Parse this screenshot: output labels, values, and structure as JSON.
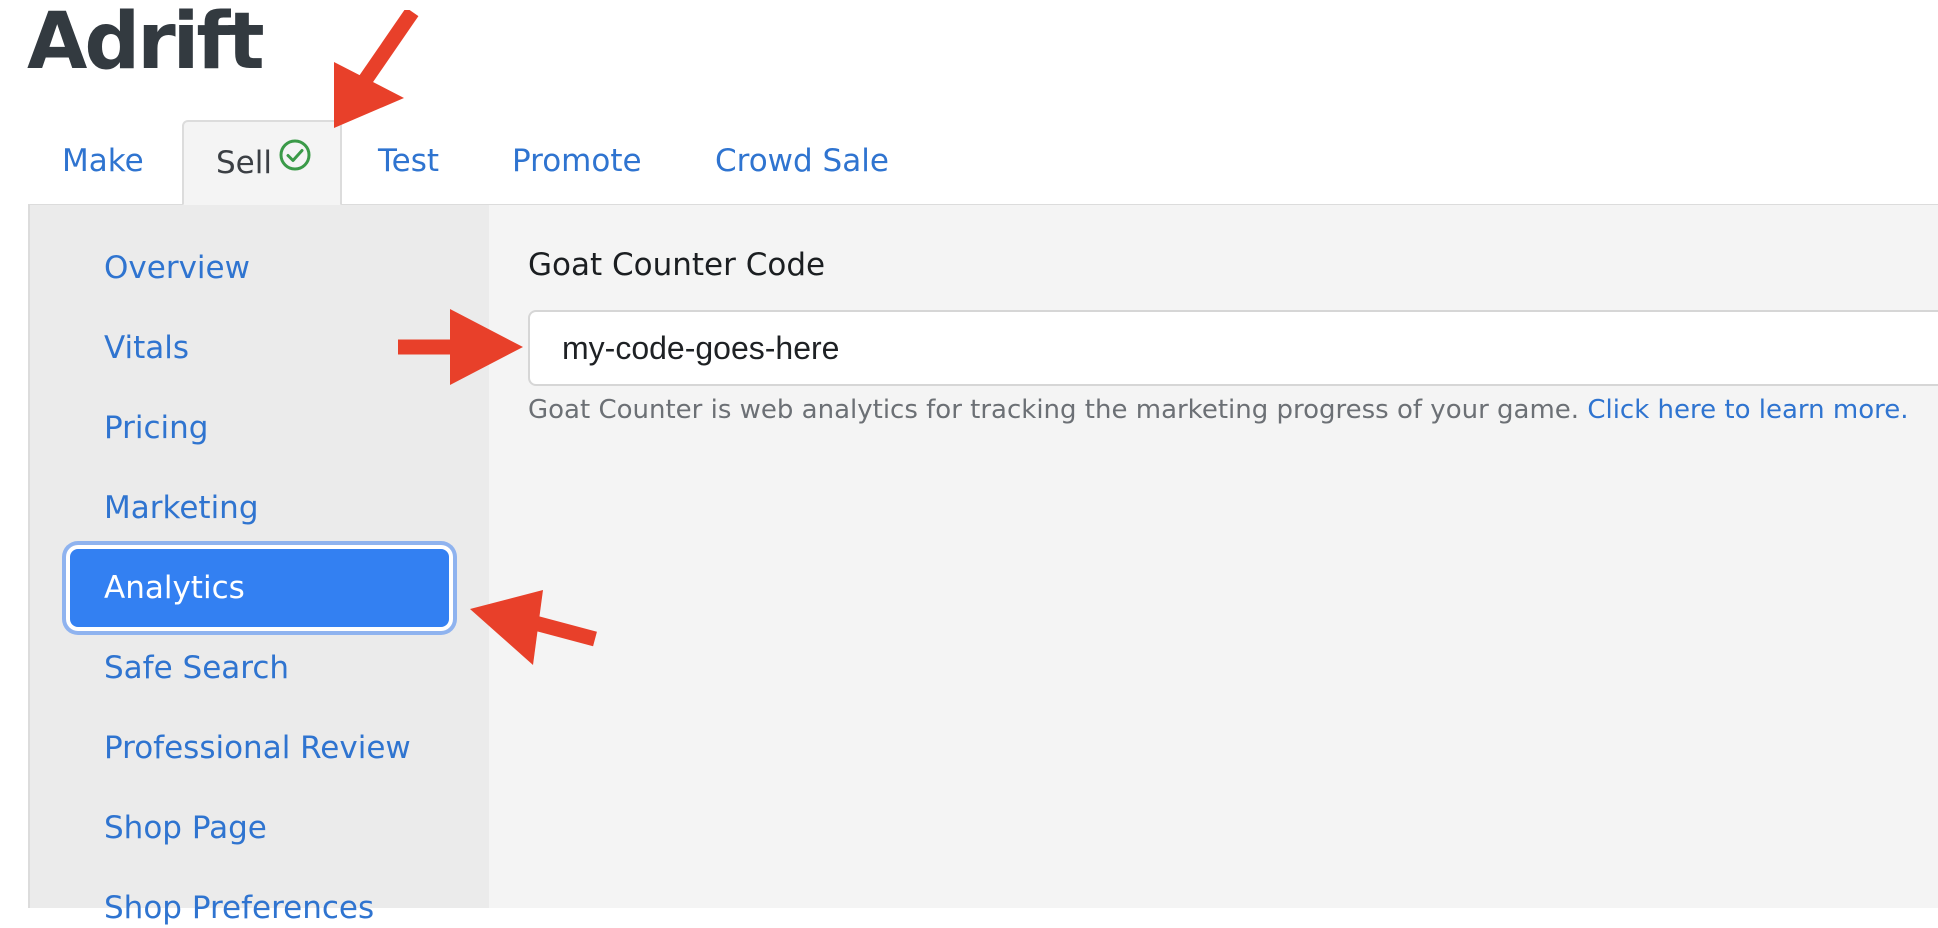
{
  "app": {
    "title": "Adrift"
  },
  "tabs": [
    {
      "label": "Make",
      "active": false
    },
    {
      "label": "Sell",
      "active": true,
      "status_icon": "check-circle-icon"
    },
    {
      "label": "Test",
      "active": false
    },
    {
      "label": "Promote",
      "active": false
    },
    {
      "label": "Crowd Sale",
      "active": false
    }
  ],
  "sidebar": {
    "items": [
      {
        "label": "Overview",
        "active": false
      },
      {
        "label": "Vitals",
        "active": false
      },
      {
        "label": "Pricing",
        "active": false
      },
      {
        "label": "Marketing",
        "active": false
      },
      {
        "label": "Analytics",
        "active": true
      },
      {
        "label": "Safe Search",
        "active": false
      },
      {
        "label": "Professional Review",
        "active": false
      },
      {
        "label": "Shop Page",
        "active": false
      },
      {
        "label": "Shop Preferences",
        "active": false
      }
    ]
  },
  "form": {
    "label": "Goat Counter Code",
    "value": "my-code-goes-here",
    "help_text": "Goat Counter is web analytics for tracking the marketing progress of your game.",
    "help_link": "Click here to learn more."
  },
  "colors": {
    "link": "#2f74d0",
    "active_nav": "#3380f2",
    "success_check": "#3a9a48",
    "annotation_arrow": "#e8402a"
  }
}
